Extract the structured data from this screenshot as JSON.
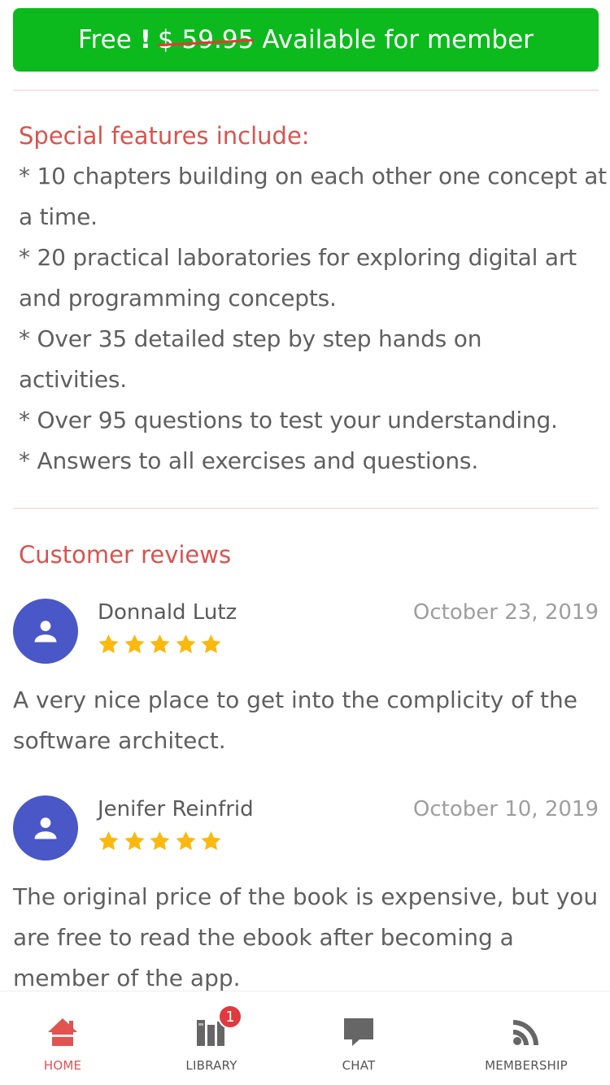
{
  "cta": {
    "prefix": "Free",
    "exclaim": "!",
    "old_price": "$ 59.95",
    "suffix": "Available for member"
  },
  "features": {
    "heading": "Special features include:",
    "items": [
      "* 10 chapters building on each other one concept at a time.",
      "* 20 practical laboratories for exploring digital art and programming concepts.",
      "* Over 35 detailed step by step hands on activities.",
      "* Over 95 questions to test your understanding.",
      "* Answers to all exercises and questions."
    ]
  },
  "reviews": {
    "title": "Customer reviews",
    "items": [
      {
        "name": "Donnald Lutz",
        "date": "October 23, 2019",
        "rating": 5,
        "text": "A very nice place to get into the complicity of the software architect."
      },
      {
        "name": "Jenifer Reinfrid",
        "date": "October 10, 2019",
        "rating": 5,
        "text": "The original price of the book is expensive, but you are free to read the ebook after becoming a member of the app."
      }
    ]
  },
  "tabbar": {
    "tabs": [
      {
        "label": "HOME",
        "icon": "home-icon",
        "active": true
      },
      {
        "label": "LIBRARY",
        "icon": "library-icon",
        "badge": "1"
      },
      {
        "label": "CHAT",
        "icon": "chat-icon"
      },
      {
        "label": "MEMBERSHIP",
        "icon": "rss-icon"
      }
    ]
  },
  "colors": {
    "cta": "#0cba1d",
    "accent": "#d9534f",
    "avatar": "#4a57c7",
    "star": "#fbb90f",
    "badge": "#e0393f"
  }
}
